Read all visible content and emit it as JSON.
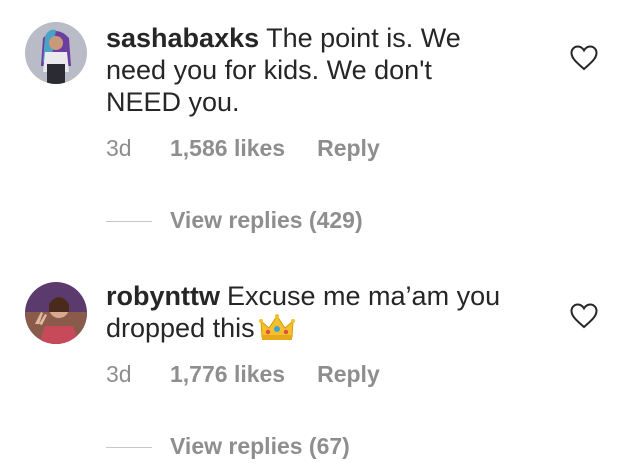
{
  "comments": [
    {
      "username": "sashabaxks",
      "text_line1": "The point is. We",
      "text_line2": "need you for kids. We don't",
      "text_line3": "NEED you.",
      "time": "3d",
      "likes": "1,586 likes",
      "reply_label": "Reply",
      "view_replies": "View replies (429)",
      "avatar_icon": "user-avatar-purple-hair",
      "like_icon": "heart-outline-icon"
    },
    {
      "username": "robynttw",
      "text_line1": "Excuse me ma’am you",
      "text_line2": "dropped this",
      "emoji": "crown-emoji",
      "time": "3d",
      "likes": "1,776 likes",
      "reply_label": "Reply",
      "view_replies": "View replies (67)",
      "avatar_icon": "user-avatar-peace-sign",
      "like_icon": "heart-outline-icon"
    }
  ],
  "colors": {
    "text": "#262626",
    "secondary": "#8e8e8e",
    "divider": "#c7c7c7"
  }
}
